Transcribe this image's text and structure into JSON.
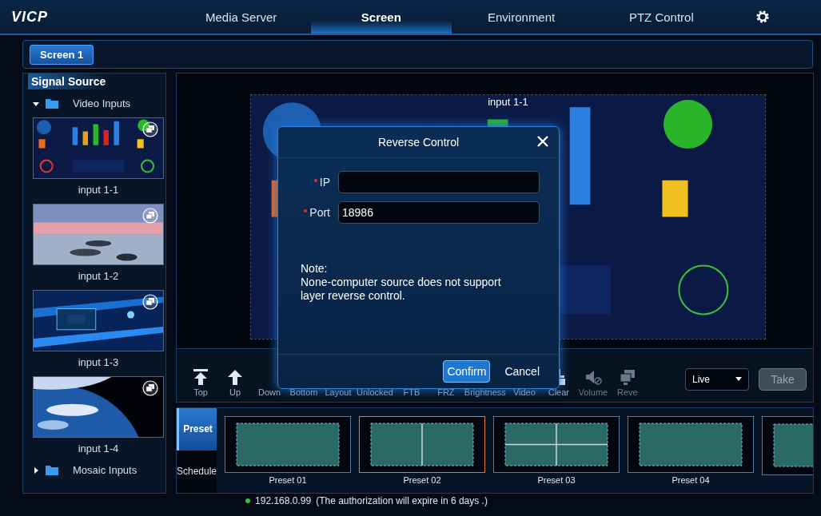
{
  "app": {
    "logo": "VICP"
  },
  "nav_tabs": [
    {
      "label": "Media Server",
      "selected": false
    },
    {
      "label": "Screen",
      "selected": true
    },
    {
      "label": "Environment",
      "selected": false
    },
    {
      "label": "PTZ Control",
      "selected": false
    }
  ],
  "screen_tabs": [
    {
      "label": "Screen 1",
      "selected": true
    }
  ],
  "signal_source": {
    "title": "Signal Source",
    "groups": [
      {
        "label": "Video Inputs",
        "expanded": true,
        "children": [
          {
            "label": "input 1-1"
          },
          {
            "label": "input 1-2"
          },
          {
            "label": "input 1-3"
          },
          {
            "label": "input 1-4"
          }
        ]
      },
      {
        "label": "Mosaic Inputs",
        "expanded": false
      }
    ]
  },
  "canvas": {
    "layers": [
      {
        "label": "input 1-1"
      }
    ]
  },
  "dialog": {
    "title": "Reverse Control",
    "fields": [
      {
        "label": "IP",
        "required": true
      },
      {
        "label": "Port",
        "required": true,
        "value": "18986"
      }
    ],
    "note_title": "Note:",
    "note": "None-computer source does not support layer reverse control.",
    "buttons": [
      {
        "label": "Confirm",
        "kind": "primary"
      },
      {
        "label": "Cancel",
        "kind": "plain"
      }
    ]
  },
  "toolbar": {
    "tools": [
      {
        "label": "Top",
        "kind": "top",
        "disabled": false
      },
      {
        "label": "Up",
        "kind": "up",
        "disabled": false
      },
      {
        "label": "Down",
        "disabled": false
      },
      {
        "label": "Bottom",
        "disabled": false
      },
      {
        "label": "Layout",
        "disabled": false
      },
      {
        "label": "Unlocked",
        "disabled": false
      },
      {
        "label": "FTB",
        "disabled": false
      },
      {
        "label": "FRZ",
        "disabled": false
      },
      {
        "label": "Brightness",
        "disabled": false
      },
      {
        "label": "Video",
        "disabled": false
      },
      {
        "label": "Clear",
        "kind": "clear",
        "disabled": false
      },
      {
        "label": "Volume",
        "kind": "volume",
        "disabled": true
      },
      {
        "label": "Reve",
        "kind": "reverse",
        "disabled": true
      }
    ],
    "mode": "Live",
    "take": {
      "label": "Take",
      "disabled": true
    }
  },
  "preset_panel": {
    "tabs": [
      {
        "label": "Preset",
        "selected": true
      },
      {
        "label": "Schedule",
        "selected": false
      }
    ],
    "presets": [
      {
        "label": "Preset 01",
        "kind": "single",
        "selected": false
      },
      {
        "label": "Preset 02",
        "kind": "split2",
        "selected": true
      },
      {
        "label": "Preset 03",
        "kind": "quad",
        "selected": false
      },
      {
        "label": "Preset 04",
        "kind": "single",
        "selected": false
      },
      {
        "kind": "single",
        "selected": false
      }
    ]
  },
  "status": {
    "ip": "192.168.0.99",
    "message": "(The authorization will expire in 6 days .)"
  }
}
